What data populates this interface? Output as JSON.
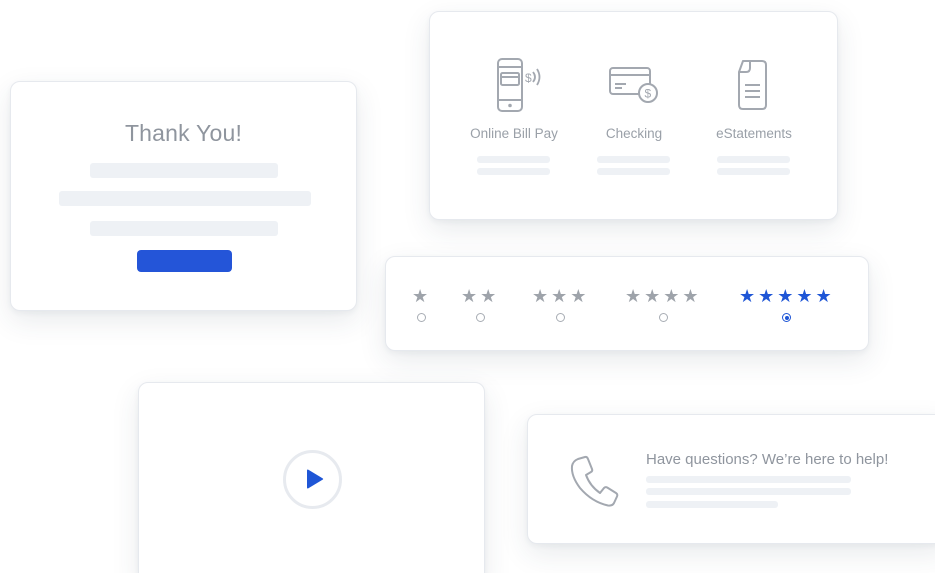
{
  "thank_you": {
    "title": "Thank You!"
  },
  "services": {
    "items": [
      {
        "label": "Online Bill Pay",
        "icon": "mobile-pay-icon"
      },
      {
        "label": "Checking",
        "icon": "checking-card-icon"
      },
      {
        "label": "eStatements",
        "icon": "document-icon"
      }
    ]
  },
  "ratings": {
    "options": [
      {
        "stars": 1,
        "selected": false
      },
      {
        "stars": 2,
        "selected": false
      },
      {
        "stars": 3,
        "selected": false
      },
      {
        "stars": 4,
        "selected": false
      },
      {
        "stars": 5,
        "selected": true
      }
    ],
    "selected_value": 5,
    "accent_color": "#1f56d6"
  },
  "video": {
    "icon": "play-icon"
  },
  "help": {
    "text": "Have questions? We’re here to help!",
    "icon": "phone-icon"
  },
  "colors": {
    "primary_button": "#2455d8",
    "placeholder_bar": "#eef1f5",
    "muted_text": "#8f959e"
  }
}
